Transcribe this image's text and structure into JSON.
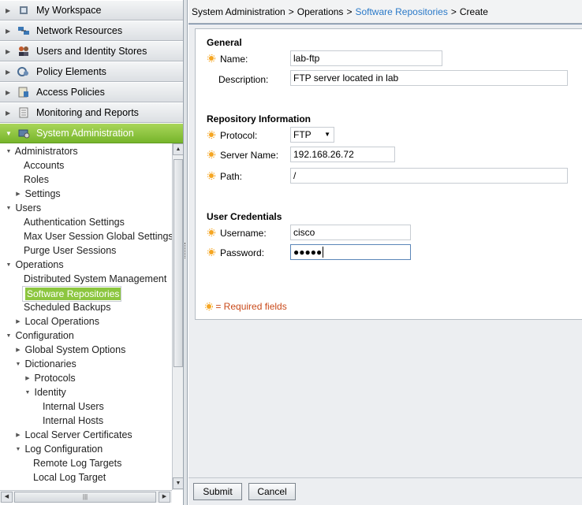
{
  "nav": {
    "drawers": [
      {
        "label": "My Workspace",
        "icon": "workspace-icon"
      },
      {
        "label": "Network Resources",
        "icon": "network-icon"
      },
      {
        "label": "Users and Identity Stores",
        "icon": "users-icon"
      },
      {
        "label": "Policy Elements",
        "icon": "policy-icon"
      },
      {
        "label": "Access Policies",
        "icon": "access-icon"
      },
      {
        "label": "Monitoring and Reports",
        "icon": "reports-icon"
      },
      {
        "label": "System Administration",
        "icon": "sysadmin-icon"
      }
    ],
    "tree": [
      "Administrators",
      "Accounts",
      "Roles",
      "Settings",
      "Users",
      "Authentication Settings",
      "Max User Session Global Settings",
      "Purge User Sessions",
      "Operations",
      "Distributed System Management",
      "Software Repositories",
      "Scheduled Backups",
      "Local Operations",
      "Configuration",
      "Global System Options",
      "Dictionaries",
      "Protocols",
      "Identity",
      "Internal Users",
      "Internal Hosts",
      "Local Server Certificates",
      "Log Configuration",
      "Remote Log Targets",
      "Local Log Target"
    ],
    "selected": "Software Repositories",
    "accent_color": "#8cc63f"
  },
  "breadcrumb": {
    "items": [
      "System Administration",
      "Operations",
      "Software Repositories",
      "Create"
    ],
    "separator": ">"
  },
  "form": {
    "general_title": "General",
    "name_label": "Name:",
    "name_value": "lab-ftp",
    "description_label": "Description:",
    "description_value": "FTP server located in lab",
    "repo_title": "Repository Information",
    "protocol_label": "Protocol:",
    "protocol_value": "FTP",
    "server_label": "Server Name:",
    "server_value": "192.168.26.72",
    "path_label": "Path:",
    "path_value": "/",
    "creds_title": "User Credentials",
    "username_label": "Username:",
    "username_value": "cisco",
    "password_label": "Password:",
    "password_value": "●●●●●",
    "required_note": "= Required fields",
    "required_color": "#c94a1a"
  },
  "actions": {
    "submit": "Submit",
    "cancel": "Cancel"
  }
}
